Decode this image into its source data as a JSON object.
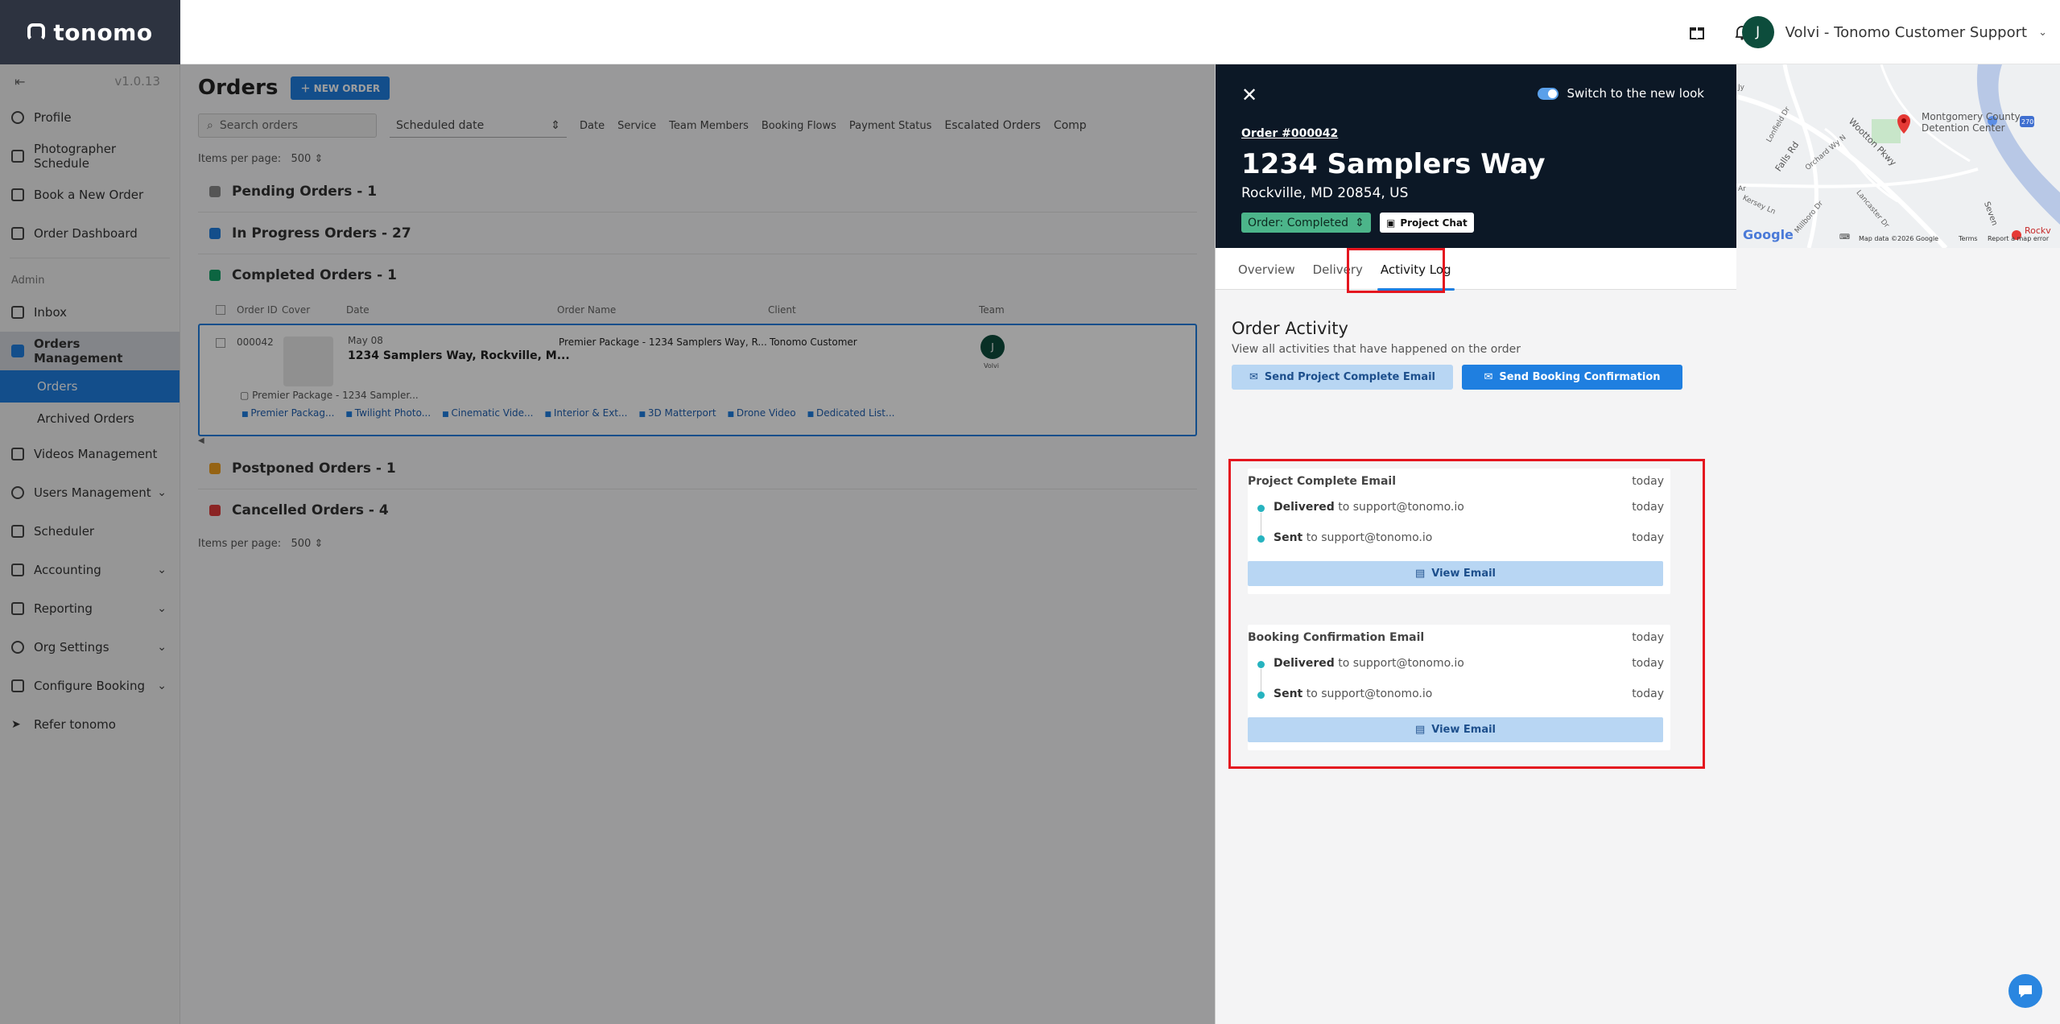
{
  "brand": {
    "name": "tonomo"
  },
  "header": {
    "user_initial": "J",
    "user_label": "Volvi - Tonomo Customer Support"
  },
  "sidebar": {
    "version": "v1.0.13",
    "items": [
      {
        "label": "Profile"
      },
      {
        "label": "Photographer Schedule"
      },
      {
        "label": "Book a New Order"
      },
      {
        "label": "Order Dashboard"
      }
    ],
    "admin_label": "Admin",
    "admin_items": [
      {
        "label": "Inbox"
      },
      {
        "label": "Orders Management"
      },
      {
        "label": "Orders"
      },
      {
        "label": "Archived Orders"
      },
      {
        "label": "Videos Management"
      },
      {
        "label": "Users Management"
      },
      {
        "label": "Scheduler"
      },
      {
        "label": "Accounting"
      },
      {
        "label": "Reporting"
      },
      {
        "label": "Org Settings"
      },
      {
        "label": "Configure Booking"
      },
      {
        "label": "Refer tonomo"
      }
    ]
  },
  "orders": {
    "title": "Orders",
    "new_order_label": "NEW ORDER",
    "search_placeholder": "Search orders",
    "date_select": "Scheduled date",
    "filters": [
      "Date",
      "Service",
      "Team Members",
      "Booking Flows",
      "Payment Status",
      "Escalated Orders",
      "Comp"
    ],
    "items_per_page_label": "Items per page:",
    "items_per_page_value": "500",
    "groups": {
      "pending": "Pending Orders - 1",
      "in_progress": "In Progress Orders - 27",
      "completed": "Completed Orders - 1",
      "postponed": "Postponed Orders - 1",
      "cancelled": "Cancelled Orders - 4"
    },
    "columns": [
      "Order ID",
      "Cover",
      "Date",
      "Order Name",
      "Client",
      "Team"
    ],
    "row": {
      "id": "000042",
      "date": "May 08",
      "address": "1234 Samplers Way, Rockville, M...",
      "name": "Premier Package - 1234 Samplers Way, R...",
      "client": "Tonomo Customer",
      "team_initial": "J",
      "team_name": "Volvi",
      "package_line": "Premier Package - 1234 Sampler...",
      "tags": [
        "Premier Packag...",
        "Twilight Photo...",
        "Cinematic Vide...",
        "Interior & Ext...",
        "3D Matterport",
        "Drone Video",
        "Dedicated List..."
      ]
    }
  },
  "panel": {
    "switch_label": "Switch to the new look",
    "order_number": "Order #000042",
    "address": "1234 Samplers Way",
    "city": "Rockville, MD 20854, US",
    "status": "Order: Completed",
    "chat_label": "Project Chat",
    "map_labels": {
      "poi": "Montgomery County Detention Center",
      "credits": "Map data ©2026 Google",
      "terms": "Terms",
      "report": "Report a map error",
      "google": "Google",
      "streets": [
        "Falls Rd",
        "Wootton Pkwy",
        "Orchard Wy N",
        "Kersey Ln",
        "Millboro Dr",
        "Lancaster Dr",
        "Seven",
        "Rockv",
        "270",
        "Lonfield Dr",
        "Jy",
        "Ar"
      ]
    },
    "tabs": [
      "Overview",
      "Delivery",
      "Activity Log"
    ],
    "activity": {
      "title": "Order Activity",
      "subtitle": "View all activities that have happened on the order",
      "btn_project_complete": "Send Project Complete Email",
      "btn_booking_confirmation": "Send Booking Confirmation",
      "cards": [
        {
          "title": "Project Complete Email",
          "time": "today",
          "events": [
            {
              "status": "Delivered",
              "detail": " to support@tonomo.io",
              "time": "today"
            },
            {
              "status": "Sent",
              "detail": " to support@tonomo.io",
              "time": "today"
            }
          ],
          "view_label": "View Email"
        },
        {
          "title": "Booking Confirmation Email",
          "time": "today",
          "events": [
            {
              "status": "Delivered",
              "detail": " to support@tonomo.io",
              "time": "today"
            },
            {
              "status": "Sent",
              "detail": " to support@tonomo.io",
              "time": "today"
            }
          ],
          "view_label": "View Email"
        }
      ]
    }
  },
  "colors": {
    "primary": "#1f7fe0",
    "panel_header": "#0c1826",
    "status_green": "#4cb58a",
    "highlight_red": "#e4161f",
    "pending": "#8a8a8a",
    "in_progress": "#1f7fe0",
    "completed": "#14a46a",
    "postponed": "#f0a020",
    "cancelled": "#e13b3b"
  }
}
